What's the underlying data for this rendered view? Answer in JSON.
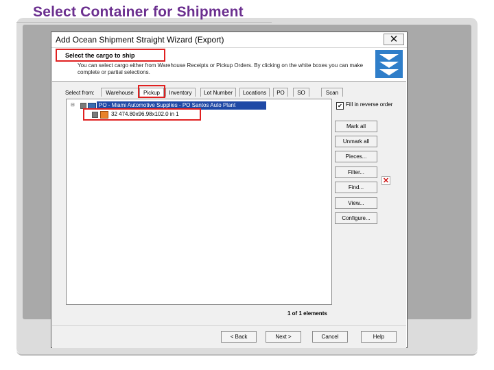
{
  "slide": {
    "title": "Select Container for Shipment"
  },
  "dialog": {
    "title": "Add Ocean Shipment Straight Wizard (Export)",
    "close_glyph": "✕",
    "header_title": "Select the cargo to ship",
    "header_desc": "You can select cargo either from Warehouse Receipts or Pickup Orders. By clicking on the white boxes you can make complete or partial selections.",
    "select_from_label": "Select from:",
    "tabs": [
      {
        "label": "Warehouse",
        "active": false
      },
      {
        "label": "Pickup",
        "active": true
      },
      {
        "label": "Inventory",
        "active": false
      },
      {
        "label": "Lot Number",
        "active": false
      },
      {
        "label": "Locations",
        "active": false
      },
      {
        "label": "PO",
        "active": false
      },
      {
        "label": "SO",
        "active": false
      },
      {
        "label": "Scan",
        "active": false
      }
    ],
    "tree": [
      {
        "expander": "⊟",
        "text": "PO - Miami Automotive Supplies - PO Santos Auto Plant",
        "selected": true,
        "icon": "shipment-icon"
      },
      {
        "text": "32   474.80x96.98x102.0 in   1",
        "selected": false,
        "icon": "box-icon"
      }
    ],
    "elements_count": "1 of 1 elements",
    "reverse_order_label": "Fill in reverse order",
    "reverse_order_checked": true,
    "reverse_check_glyph": "✔",
    "side_buttons": [
      "Mark all",
      "Unmark all",
      "Pieces...",
      "Filter...",
      "Find...",
      "View...",
      "Configure..."
    ],
    "filter_clear_glyph": "✕",
    "footer_buttons": [
      "< Back",
      "Next >",
      "Cancel",
      "Help"
    ]
  },
  "colors": {
    "title_purple": "#6b2f8f",
    "highlight_red": "#e02020",
    "selection_blue": "#1f49a6",
    "logo_blue": "#2f7ec9"
  }
}
